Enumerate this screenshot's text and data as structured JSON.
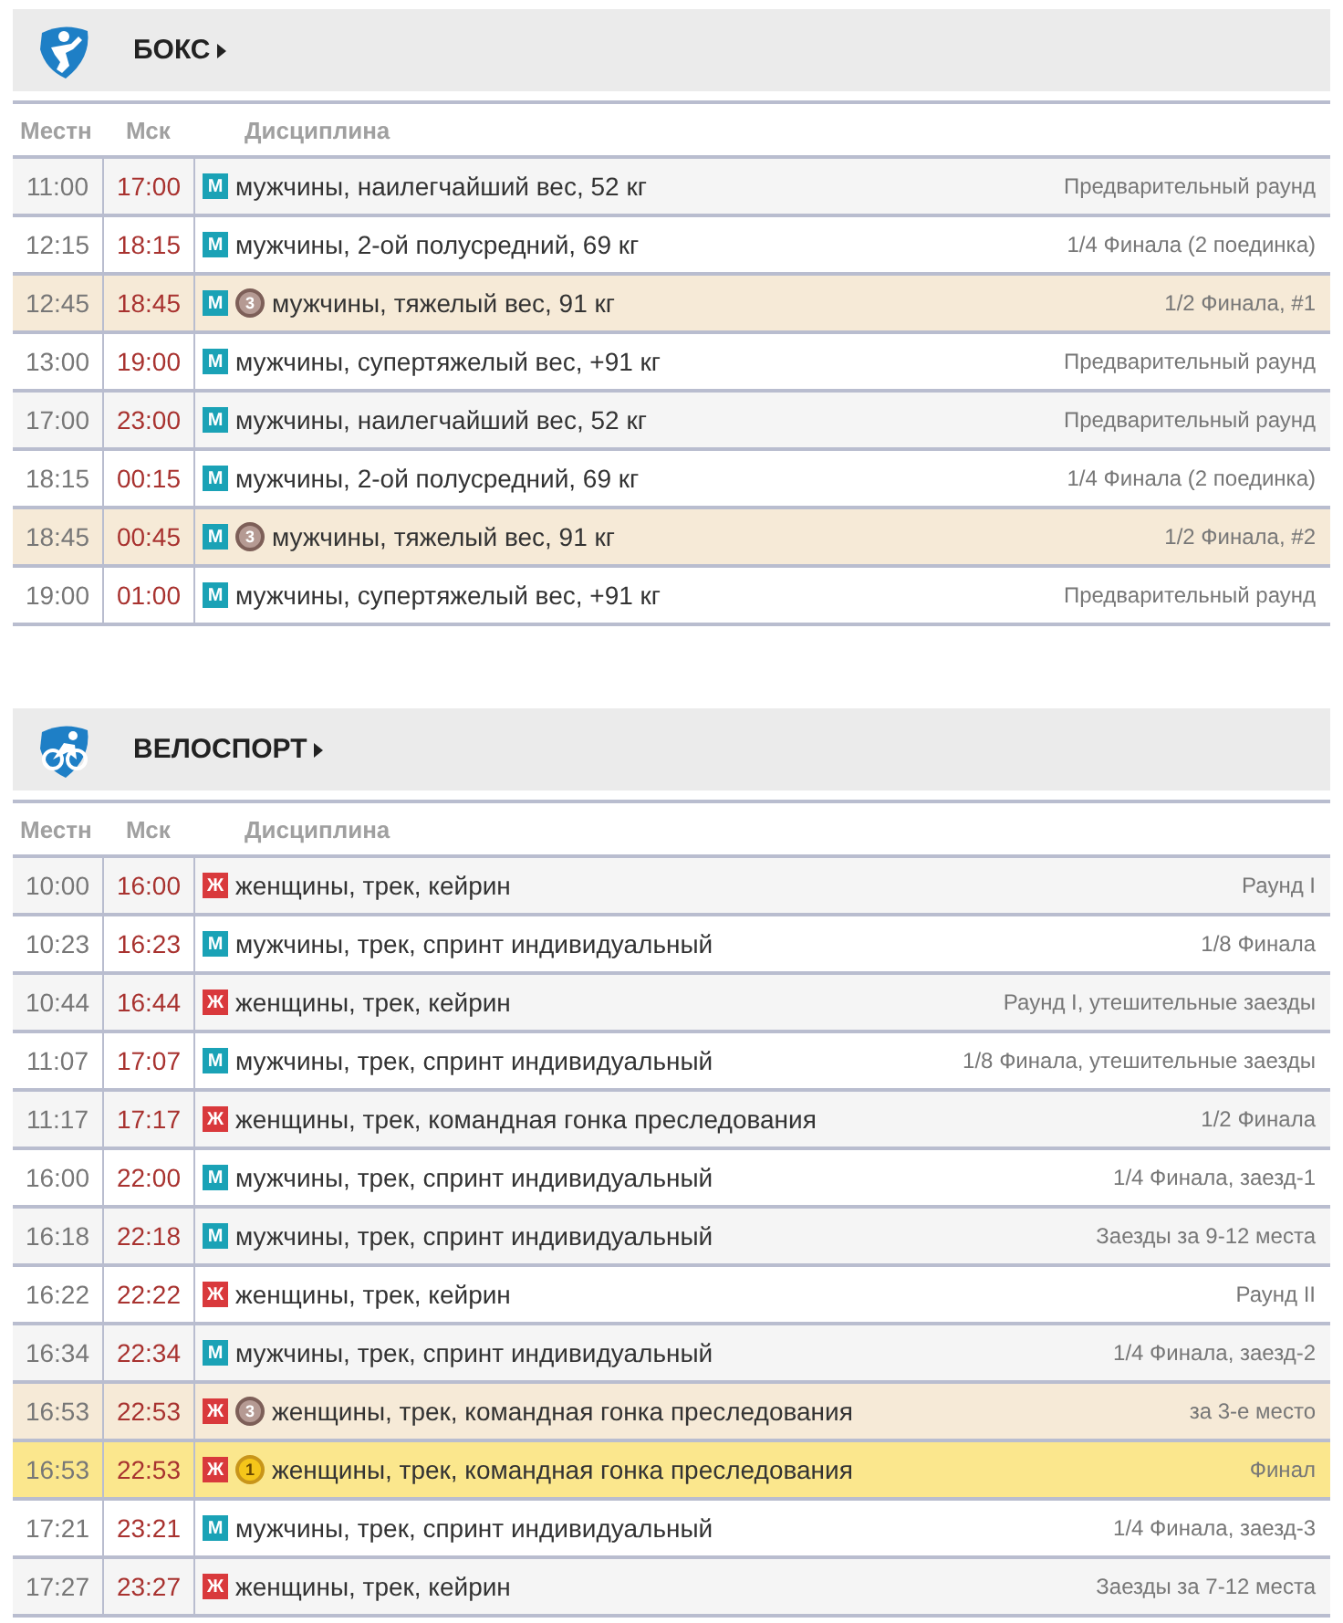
{
  "sections": [
    {
      "title": "БОКС",
      "kind": "boxing",
      "columns": [
        "Местн",
        "Мск",
        "Дисциплина"
      ],
      "rows": [
        {
          "local": "11:00",
          "msk": "17:00",
          "gender": {
            "label": "М",
            "kind": "men"
          },
          "discipline": "мужчины, наилегчайший вес, 52 кг",
          "stage": "Предварительный раунд"
        },
        {
          "local": "12:15",
          "msk": "18:15",
          "gender": {
            "label": "М",
            "kind": "men"
          },
          "discipline": "мужчины, 2-ой полусредний, 69 кг",
          "stage": "1/4 Финала (2 поединка)"
        },
        {
          "local": "12:45",
          "msk": "18:45",
          "gender": {
            "label": "М",
            "kind": "men"
          },
          "medal": {
            "place": "3",
            "kind": "bronze"
          },
          "discipline": "мужчины, тяжелый вес, 91 кг",
          "stage": "1/2 Финала, #1"
        },
        {
          "local": "13:00",
          "msk": "19:00",
          "gender": {
            "label": "М",
            "kind": "men"
          },
          "discipline": "мужчины, супертяжелый вес, +91 кг",
          "stage": "Предварительный раунд"
        },
        {
          "local": "17:00",
          "msk": "23:00",
          "gender": {
            "label": "М",
            "kind": "men"
          },
          "discipline": "мужчины, наилегчайший вес, 52 кг",
          "stage": "Предварительный раунд"
        },
        {
          "local": "18:15",
          "msk": "00:15",
          "gender": {
            "label": "М",
            "kind": "men"
          },
          "discipline": "мужчины, 2-ой полусредний, 69 кг",
          "stage": "1/4 Финала (2 поединка)"
        },
        {
          "local": "18:45",
          "msk": "00:45",
          "gender": {
            "label": "М",
            "kind": "men"
          },
          "medal": {
            "place": "3",
            "kind": "bronze"
          },
          "discipline": "мужчины, тяжелый вес, 91 кг",
          "stage": "1/2 Финала, #2"
        },
        {
          "local": "19:00",
          "msk": "01:00",
          "gender": {
            "label": "М",
            "kind": "men"
          },
          "discipline": "мужчины, супертяжелый вес, +91 кг",
          "stage": "Предварительный раунд"
        }
      ]
    },
    {
      "title": "ВЕЛОСПОРТ",
      "kind": "cycling",
      "columns": [
        "Местн",
        "Мск",
        "Дисциплина"
      ],
      "rows": [
        {
          "local": "10:00",
          "msk": "16:00",
          "gender": {
            "label": "Ж",
            "kind": "women"
          },
          "discipline": "женщины, трек, кейрин",
          "stage": "Раунд I"
        },
        {
          "local": "10:23",
          "msk": "16:23",
          "gender": {
            "label": "М",
            "kind": "men"
          },
          "discipline": "мужчины, трек, спринт индивидуальный",
          "stage": "1/8 Финала"
        },
        {
          "local": "10:44",
          "msk": "16:44",
          "gender": {
            "label": "Ж",
            "kind": "women"
          },
          "discipline": "женщины, трек, кейрин",
          "stage": "Раунд I, утешительные заезды"
        },
        {
          "local": "11:07",
          "msk": "17:07",
          "gender": {
            "label": "М",
            "kind": "men"
          },
          "discipline": "мужчины, трек, спринт индивидуальный",
          "stage": "1/8 Финала, утешительные заезды"
        },
        {
          "local": "11:17",
          "msk": "17:17",
          "gender": {
            "label": "Ж",
            "kind": "women"
          },
          "discipline": "женщины, трек, командная гонка преследования",
          "stage": "1/2 Финала"
        },
        {
          "local": "16:00",
          "msk": "22:00",
          "gender": {
            "label": "М",
            "kind": "men"
          },
          "discipline": "мужчины, трек, спринт индивидуальный",
          "stage": "1/4 Финала, заезд-1"
        },
        {
          "local": "16:18",
          "msk": "22:18",
          "gender": {
            "label": "М",
            "kind": "men"
          },
          "discipline": "мужчины, трек, спринт индивидуальный",
          "stage": "Заезды за 9-12 места"
        },
        {
          "local": "16:22",
          "msk": "22:22",
          "gender": {
            "label": "Ж",
            "kind": "women"
          },
          "discipline": "женщины, трек, кейрин",
          "stage": "Раунд II"
        },
        {
          "local": "16:34",
          "msk": "22:34",
          "gender": {
            "label": "М",
            "kind": "men"
          },
          "discipline": "мужчины, трек, спринт индивидуальный",
          "stage": "1/4 Финала, заезд-2"
        },
        {
          "local": "16:53",
          "msk": "22:53",
          "gender": {
            "label": "Ж",
            "kind": "women"
          },
          "medal": {
            "place": "3",
            "kind": "bronze"
          },
          "discipline": "женщины, трек, командная гонка преследования",
          "stage": "за 3-е место"
        },
        {
          "local": "16:53",
          "msk": "22:53",
          "gender": {
            "label": "Ж",
            "kind": "women"
          },
          "medal": {
            "place": "1",
            "kind": "gold"
          },
          "discipline": "женщины, трек, командная гонка преследования",
          "stage": "Финал"
        },
        {
          "local": "17:21",
          "msk": "23:21",
          "gender": {
            "label": "М",
            "kind": "men"
          },
          "discipline": "мужчины, трек, спринт индивидуальный",
          "stage": "1/4 Финала, заезд-3"
        },
        {
          "local": "17:27",
          "msk": "23:27",
          "gender": {
            "label": "Ж",
            "kind": "women"
          },
          "discipline": "женщины, трек, кейрин",
          "stage": "Заезды за 7-12 места"
        }
      ]
    }
  ]
}
